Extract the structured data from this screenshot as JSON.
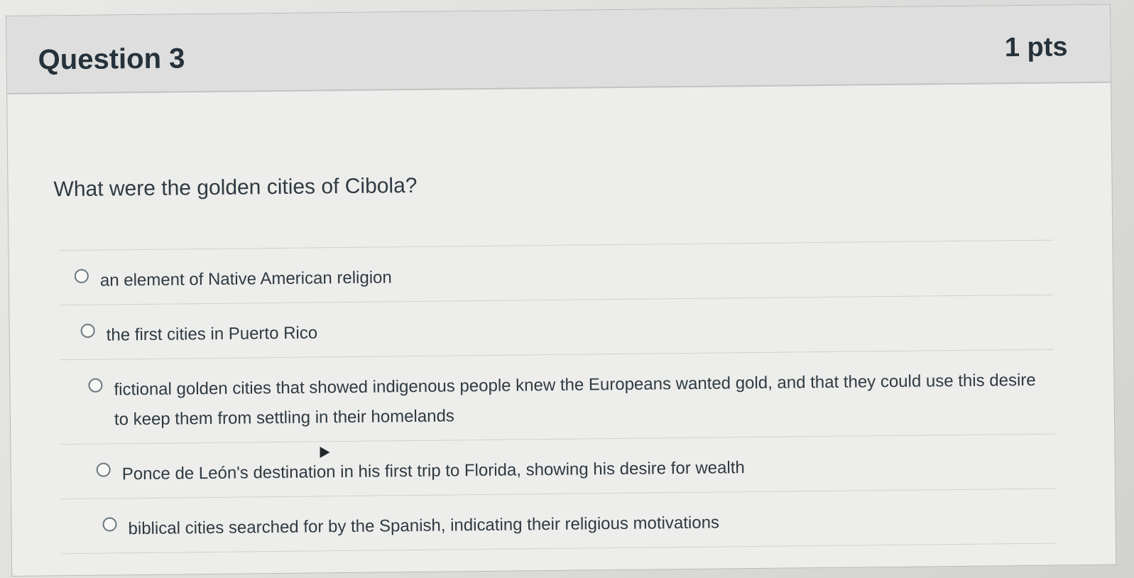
{
  "question": {
    "title": "Question 3",
    "points": "1 pts",
    "prompt": "What were the golden cities of Cibola?"
  },
  "answers": [
    {
      "label": "an element of Native American religion",
      "selected": false
    },
    {
      "label": "the first cities in Puerto Rico",
      "selected": false
    },
    {
      "label": "fictional golden cities that showed indigenous people knew the Europeans wanted gold, and that they could use this desire to keep them from settling in their homelands",
      "selected": false
    },
    {
      "label": "Ponce de León's destination in his first trip to Florida, showing his desire for wealth",
      "selected": false
    },
    {
      "label": "biblical cities searched for by the Spanish, indicating their religious motivations",
      "selected": false
    }
  ],
  "colors": {
    "header_bg": "#dedede",
    "card_bg": "#ededeb",
    "text": "#2d3b45",
    "radio_border": "#6c7780"
  }
}
